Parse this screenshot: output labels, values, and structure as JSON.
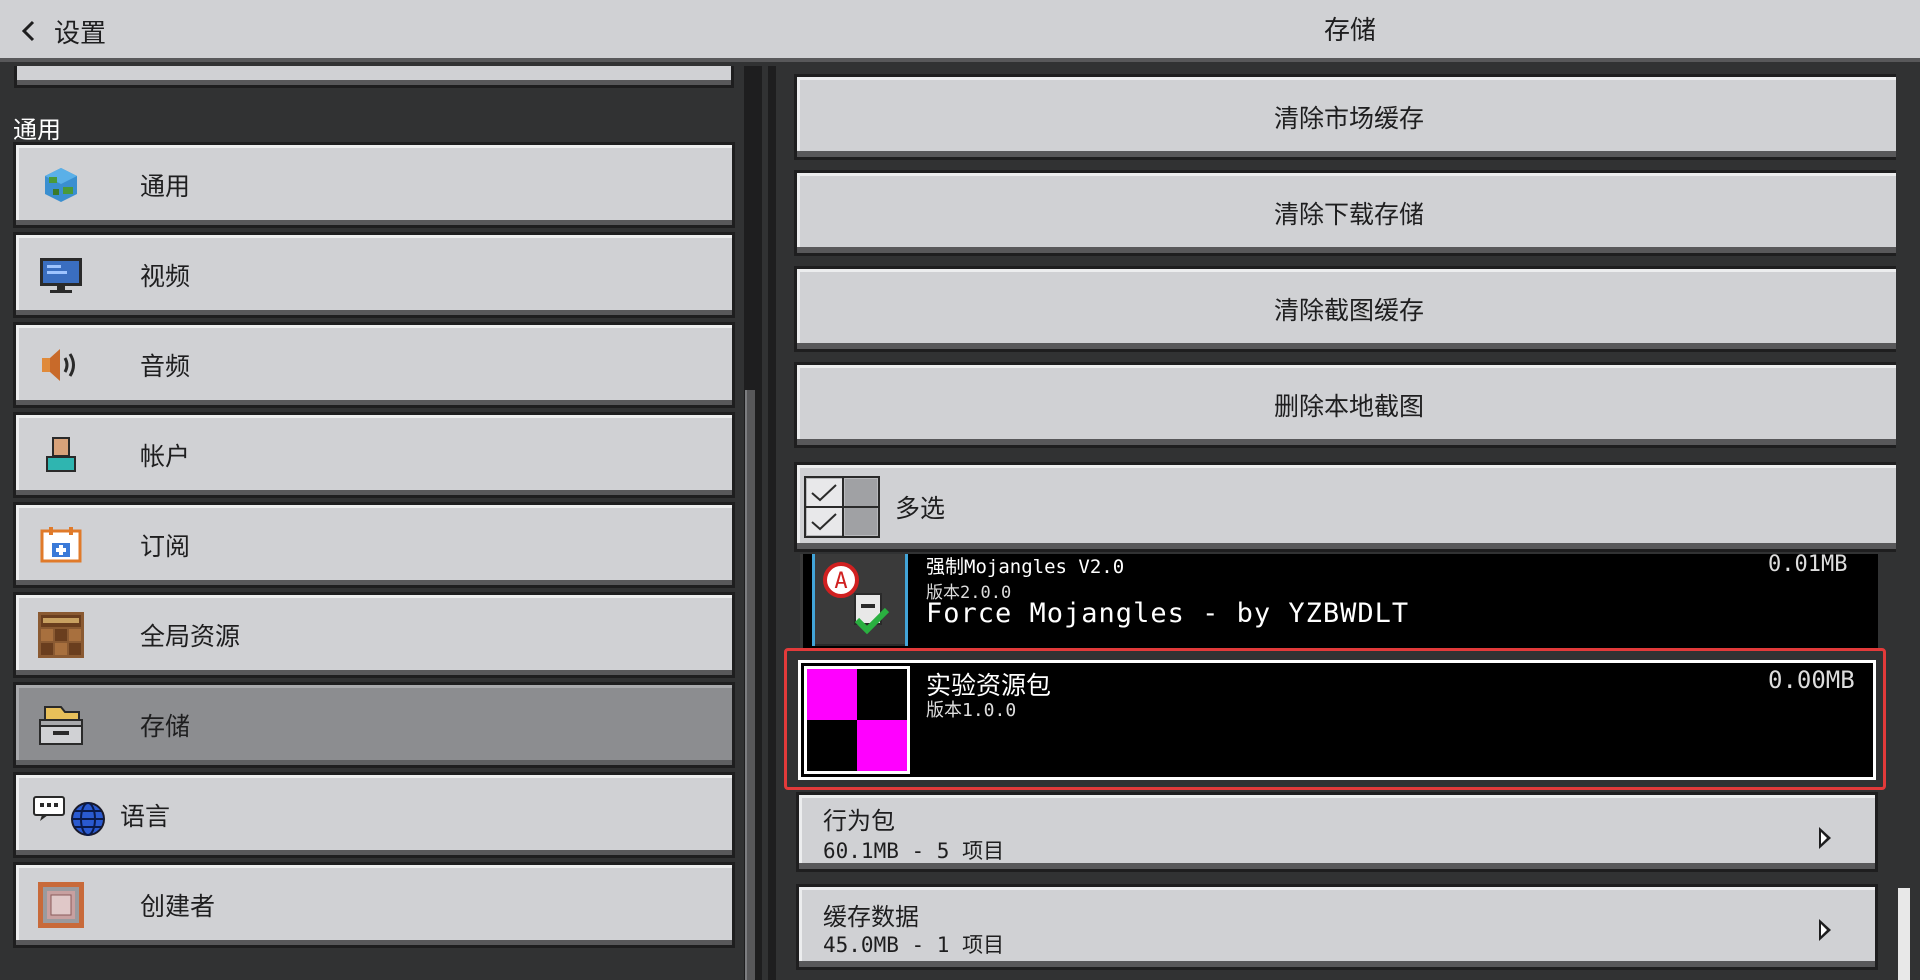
{
  "header": {
    "back_label": "设置",
    "title": "存储"
  },
  "sidebar": {
    "section_title": "通用",
    "items": [
      {
        "label": "通用",
        "icon": "globe-cube-icon"
      },
      {
        "label": "视频",
        "icon": "monitor-icon"
      },
      {
        "label": "音频",
        "icon": "speaker-icon"
      },
      {
        "label": "帐户",
        "icon": "account-icon"
      },
      {
        "label": "订阅",
        "icon": "subscription-icon"
      },
      {
        "label": "全局资源",
        "icon": "resource-pack-icon"
      },
      {
        "label": "存储",
        "icon": "storage-box-icon",
        "selected": true
      },
      {
        "label": "语言",
        "icon": "language-icon"
      },
      {
        "label": "创建者",
        "icon": "creator-icon"
      }
    ]
  },
  "actions": {
    "clear_marketplace_cache": "清除市场缓存",
    "clear_download_storage": "清除下载存储",
    "clear_screenshot_cache": "清除截图缓存",
    "delete_local_screenshots": "删除本地截图",
    "multi_select": "多选"
  },
  "packs": [
    {
      "name": "强制Mojangles V2.0",
      "version": "版本2.0.0",
      "description": "Force Mojangles - by YZBWDLT",
      "size": "0.01MB"
    },
    {
      "name": "实验资源包",
      "version": "版本1.0.0",
      "size": "0.00MB"
    }
  ],
  "folders": [
    {
      "title": "行为包",
      "summary": "60.1MB - 5 项目"
    },
    {
      "title": "缓存数据",
      "summary": "45.0MB - 1 项目"
    }
  ],
  "colors": {
    "highlight": "#e23a3a",
    "magenta": "#ff00ff",
    "selected_bg": "#8c8d90",
    "button_bg": "#d0d1d4"
  }
}
